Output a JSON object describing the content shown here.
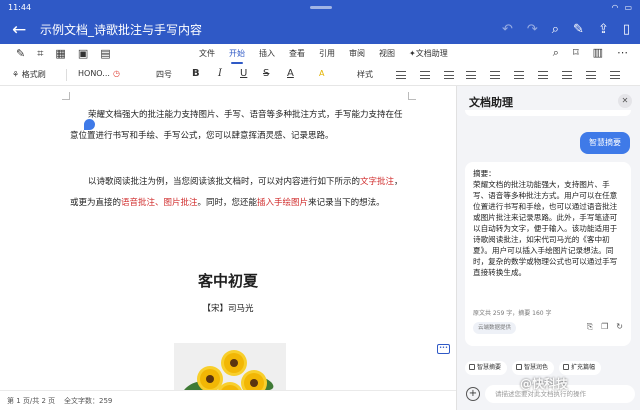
{
  "status": {
    "time": "11:44"
  },
  "title_bar": {
    "back_icon": "back-arrow-icon",
    "doc_title": "示例文档_诗歌批注与手写内容",
    "actions": [
      "undo-icon",
      "redo-icon",
      "search-icon",
      "pen-icon",
      "share-icon",
      "book-icon"
    ]
  },
  "menu": {
    "tabs": [
      {
        "label": "文件",
        "active": false
      },
      {
        "label": "开始",
        "active": true
      },
      {
        "label": "插入",
        "active": false
      },
      {
        "label": "查看",
        "active": false
      },
      {
        "label": "引用",
        "active": false
      },
      {
        "label": "审阅",
        "active": false
      },
      {
        "label": "视图",
        "active": false
      },
      {
        "label": "文档助理",
        "active": false
      }
    ]
  },
  "format": {
    "painter": "格式刷",
    "font": "HONO...",
    "size": "四号",
    "bold": "B",
    "italic": "I",
    "underline": "U",
    "strike": "S",
    "font_color": "A",
    "highlight": "A",
    "style": "样式"
  },
  "document": {
    "para1": "荣耀文档强大的批注能力支持图片、手写、语音等多种批注方式，手写能力支持在任意位置进行书写和手绘、手写公式，您可以肆意挥洒灵感、记录思路。",
    "para2_a": "以诗歌阅读批注为例，当您阅读该批文档时，可以对内容进行如下所示的",
    "para2_red1": "文字批注",
    "para2_b": "，或更为直接的",
    "para2_red2": "语音批注、图片批注",
    "para2_c": "。同时，您还能",
    "para2_red3": "插入手绘图片",
    "para2_d": "来记录当下的想法。",
    "poem_title": "客中初夏",
    "poem_author": "【宋】司马光",
    "colors": {
      "accent": "#2f59c6",
      "annotation_red": "#d02c2c"
    }
  },
  "bottom": {
    "page_info": "第 1 页/共 2 页",
    "word_count": "全文字数：259"
  },
  "assistant": {
    "title": "文档助理",
    "summary_button": "智慧摘要",
    "summary_text": "摘要：\n荣耀文档的批注功能强大，支持图片、手写、语音等多种批注方式。用户可以在任意位置进行书写和手绘，也可以通过语音批注或图片批注来记录思路。此外，手写笔迹可以自动转为文字，便于输入。该功能适用于诗歌阅读批注，如宋代司马光的《客中初夏》。用户可以插入手绘图片记录想法。同时，复杂的数学或物理公式也可以通过手写直接转换生成。",
    "stats": "原文共 259 字，摘要 160 字",
    "ai_tag": "云端数据提供",
    "quick_actions": [
      "智慧摘要",
      "智慧润色",
      "扩充篇幅"
    ],
    "input_placeholder": "请描述您要对此文档执行的操作"
  },
  "watermark": "@快科技"
}
